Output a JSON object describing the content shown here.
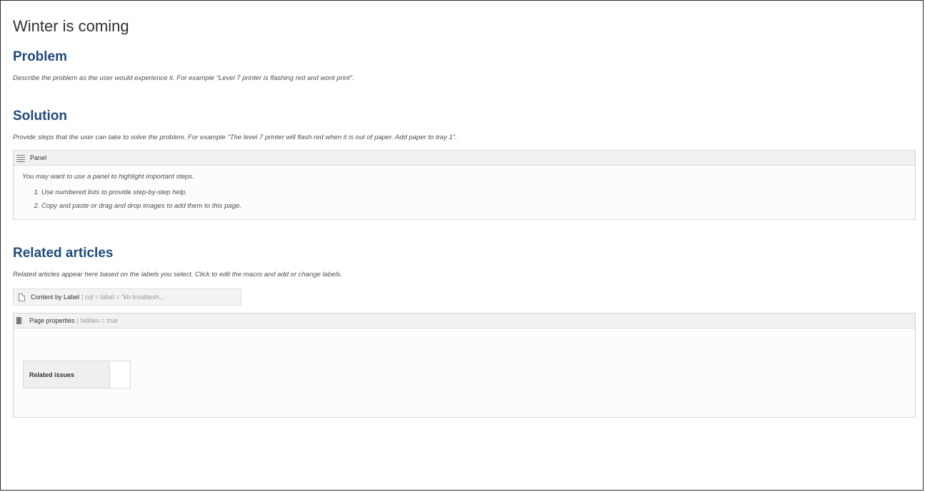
{
  "page": {
    "title": "Winter is coming"
  },
  "problem": {
    "heading": "Problem",
    "hint": "Describe the problem as the user would experience it. For example \"Level 7 printer is flashing red and wont print\"."
  },
  "solution": {
    "heading": "Solution",
    "hint": "Provide steps that the user can take to solve the problem. For example \"The level 7 printer will flash red when it is out of paper. Add paper to tray 1\".",
    "panel": {
      "title": "Panel",
      "intro": "You may want to use a panel to highlight important steps.",
      "steps": [
        "Use numbered lists to provide step-by-step help.",
        "Copy and paste or drag and drop images to add them to this page."
      ]
    }
  },
  "related": {
    "heading": "Related articles",
    "hint": "Related articles appear here based on the labels you select. Click to edit the macro and add or change labels.",
    "content_by_label": {
      "name": "Content by Label",
      "params": "| cql = label = \"kb-troublesh..."
    },
    "page_properties": {
      "name": "Page properties",
      "params": "| hidden = true",
      "table_header": "Related issues"
    }
  },
  "icons": {
    "panel": "lines-icon",
    "content_by_label": "document-icon",
    "page_properties": "page-properties-icon"
  }
}
